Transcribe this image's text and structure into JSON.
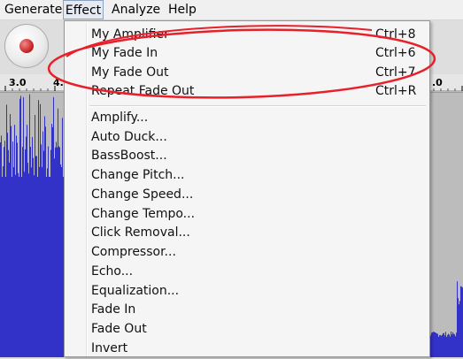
{
  "menubar": {
    "items": [
      {
        "label": "Generate"
      },
      {
        "label": "Effect"
      },
      {
        "label": "Analyze"
      },
      {
        "label": "Help"
      }
    ]
  },
  "ruler": {
    "labels_left": [
      "3.0",
      "4."
    ],
    "label_right": ".0"
  },
  "effect_menu": {
    "custom_items": [
      {
        "label": "My Amplifier",
        "accel": "Ctrl+8"
      },
      {
        "label": "My Fade In",
        "accel": "Ctrl+6"
      },
      {
        "label": "My Fade Out",
        "accel": "Ctrl+7"
      },
      {
        "label": "Repeat Fade Out",
        "accel": "Ctrl+R"
      }
    ],
    "items": [
      {
        "label": "Amplify..."
      },
      {
        "label": "Auto Duck..."
      },
      {
        "label": "BassBoost..."
      },
      {
        "label": "Change Pitch..."
      },
      {
        "label": "Change Speed..."
      },
      {
        "label": "Change Tempo..."
      },
      {
        "label": "Click Removal..."
      },
      {
        "label": "Compressor..."
      },
      {
        "label": "Echo..."
      },
      {
        "label": "Equalization..."
      },
      {
        "label": "Fade In"
      },
      {
        "label": "Fade Out"
      },
      {
        "label": "Invert"
      }
    ]
  },
  "colors": {
    "waveform": "#3232c8",
    "annotation": "#e8202a",
    "record": "#c41a1a"
  },
  "icons": [
    "record-icon"
  ]
}
